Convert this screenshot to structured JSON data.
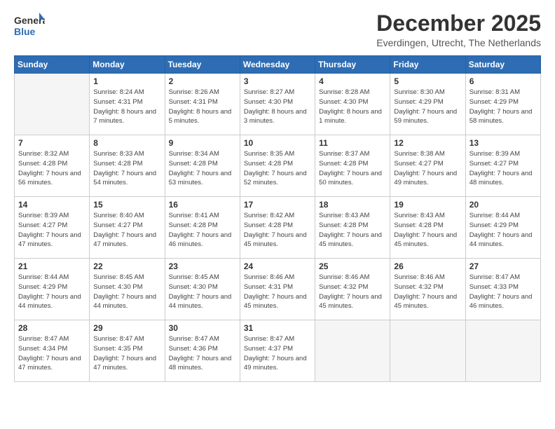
{
  "logo": {
    "general": "General",
    "blue": "Blue"
  },
  "header": {
    "month": "December 2025",
    "location": "Everdingen, Utrecht, The Netherlands"
  },
  "weekdays": [
    "Sunday",
    "Monday",
    "Tuesday",
    "Wednesday",
    "Thursday",
    "Friday",
    "Saturday"
  ],
  "weeks": [
    [
      {
        "day": "",
        "sunrise": "",
        "sunset": "",
        "daylight": ""
      },
      {
        "day": "1",
        "sunrise": "Sunrise: 8:24 AM",
        "sunset": "Sunset: 4:31 PM",
        "daylight": "Daylight: 8 hours and 7 minutes."
      },
      {
        "day": "2",
        "sunrise": "Sunrise: 8:26 AM",
        "sunset": "Sunset: 4:31 PM",
        "daylight": "Daylight: 8 hours and 5 minutes."
      },
      {
        "day": "3",
        "sunrise": "Sunrise: 8:27 AM",
        "sunset": "Sunset: 4:30 PM",
        "daylight": "Daylight: 8 hours and 3 minutes."
      },
      {
        "day": "4",
        "sunrise": "Sunrise: 8:28 AM",
        "sunset": "Sunset: 4:30 PM",
        "daylight": "Daylight: 8 hours and 1 minute."
      },
      {
        "day": "5",
        "sunrise": "Sunrise: 8:30 AM",
        "sunset": "Sunset: 4:29 PM",
        "daylight": "Daylight: 7 hours and 59 minutes."
      },
      {
        "day": "6",
        "sunrise": "Sunrise: 8:31 AM",
        "sunset": "Sunset: 4:29 PM",
        "daylight": "Daylight: 7 hours and 58 minutes."
      }
    ],
    [
      {
        "day": "7",
        "sunrise": "Sunrise: 8:32 AM",
        "sunset": "Sunset: 4:28 PM",
        "daylight": "Daylight: 7 hours and 56 minutes."
      },
      {
        "day": "8",
        "sunrise": "Sunrise: 8:33 AM",
        "sunset": "Sunset: 4:28 PM",
        "daylight": "Daylight: 7 hours and 54 minutes."
      },
      {
        "day": "9",
        "sunrise": "Sunrise: 8:34 AM",
        "sunset": "Sunset: 4:28 PM",
        "daylight": "Daylight: 7 hours and 53 minutes."
      },
      {
        "day": "10",
        "sunrise": "Sunrise: 8:35 AM",
        "sunset": "Sunset: 4:28 PM",
        "daylight": "Daylight: 7 hours and 52 minutes."
      },
      {
        "day": "11",
        "sunrise": "Sunrise: 8:37 AM",
        "sunset": "Sunset: 4:28 PM",
        "daylight": "Daylight: 7 hours and 50 minutes."
      },
      {
        "day": "12",
        "sunrise": "Sunrise: 8:38 AM",
        "sunset": "Sunset: 4:27 PM",
        "daylight": "Daylight: 7 hours and 49 minutes."
      },
      {
        "day": "13",
        "sunrise": "Sunrise: 8:39 AM",
        "sunset": "Sunset: 4:27 PM",
        "daylight": "Daylight: 7 hours and 48 minutes."
      }
    ],
    [
      {
        "day": "14",
        "sunrise": "Sunrise: 8:39 AM",
        "sunset": "Sunset: 4:27 PM",
        "daylight": "Daylight: 7 hours and 47 minutes."
      },
      {
        "day": "15",
        "sunrise": "Sunrise: 8:40 AM",
        "sunset": "Sunset: 4:27 PM",
        "daylight": "Daylight: 7 hours and 47 minutes."
      },
      {
        "day": "16",
        "sunrise": "Sunrise: 8:41 AM",
        "sunset": "Sunset: 4:28 PM",
        "daylight": "Daylight: 7 hours and 46 minutes."
      },
      {
        "day": "17",
        "sunrise": "Sunrise: 8:42 AM",
        "sunset": "Sunset: 4:28 PM",
        "daylight": "Daylight: 7 hours and 45 minutes."
      },
      {
        "day": "18",
        "sunrise": "Sunrise: 8:43 AM",
        "sunset": "Sunset: 4:28 PM",
        "daylight": "Daylight: 7 hours and 45 minutes."
      },
      {
        "day": "19",
        "sunrise": "Sunrise: 8:43 AM",
        "sunset": "Sunset: 4:28 PM",
        "daylight": "Daylight: 7 hours and 45 minutes."
      },
      {
        "day": "20",
        "sunrise": "Sunrise: 8:44 AM",
        "sunset": "Sunset: 4:29 PM",
        "daylight": "Daylight: 7 hours and 44 minutes."
      }
    ],
    [
      {
        "day": "21",
        "sunrise": "Sunrise: 8:44 AM",
        "sunset": "Sunset: 4:29 PM",
        "daylight": "Daylight: 7 hours and 44 minutes."
      },
      {
        "day": "22",
        "sunrise": "Sunrise: 8:45 AM",
        "sunset": "Sunset: 4:30 PM",
        "daylight": "Daylight: 7 hours and 44 minutes."
      },
      {
        "day": "23",
        "sunrise": "Sunrise: 8:45 AM",
        "sunset": "Sunset: 4:30 PM",
        "daylight": "Daylight: 7 hours and 44 minutes."
      },
      {
        "day": "24",
        "sunrise": "Sunrise: 8:46 AM",
        "sunset": "Sunset: 4:31 PM",
        "daylight": "Daylight: 7 hours and 45 minutes."
      },
      {
        "day": "25",
        "sunrise": "Sunrise: 8:46 AM",
        "sunset": "Sunset: 4:32 PM",
        "daylight": "Daylight: 7 hours and 45 minutes."
      },
      {
        "day": "26",
        "sunrise": "Sunrise: 8:46 AM",
        "sunset": "Sunset: 4:32 PM",
        "daylight": "Daylight: 7 hours and 45 minutes."
      },
      {
        "day": "27",
        "sunrise": "Sunrise: 8:47 AM",
        "sunset": "Sunset: 4:33 PM",
        "daylight": "Daylight: 7 hours and 46 minutes."
      }
    ],
    [
      {
        "day": "28",
        "sunrise": "Sunrise: 8:47 AM",
        "sunset": "Sunset: 4:34 PM",
        "daylight": "Daylight: 7 hours and 47 minutes."
      },
      {
        "day": "29",
        "sunrise": "Sunrise: 8:47 AM",
        "sunset": "Sunset: 4:35 PM",
        "daylight": "Daylight: 7 hours and 47 minutes."
      },
      {
        "day": "30",
        "sunrise": "Sunrise: 8:47 AM",
        "sunset": "Sunset: 4:36 PM",
        "daylight": "Daylight: 7 hours and 48 minutes."
      },
      {
        "day": "31",
        "sunrise": "Sunrise: 8:47 AM",
        "sunset": "Sunset: 4:37 PM",
        "daylight": "Daylight: 7 hours and 49 minutes."
      },
      {
        "day": "",
        "sunrise": "",
        "sunset": "",
        "daylight": ""
      },
      {
        "day": "",
        "sunrise": "",
        "sunset": "",
        "daylight": ""
      },
      {
        "day": "",
        "sunrise": "",
        "sunset": "",
        "daylight": ""
      }
    ]
  ]
}
